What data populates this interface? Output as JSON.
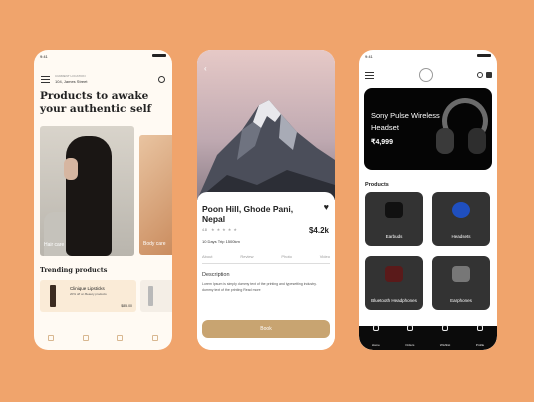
{
  "phone1": {
    "time": "9:41",
    "location_label": "CURRENT LOCATION",
    "location": "104, James Street",
    "headline": "Products to awake your authentic self",
    "card1_label": "Hair care",
    "card2_label": "Body care",
    "trending_title": "Trending products",
    "product": {
      "name": "Clinique Lipsticks",
      "desc": "20% off on Beauty products",
      "price": "$85.00"
    }
  },
  "phone2": {
    "title": "Poon Hill, Ghode Pani, Nepal",
    "rating": "4.8",
    "stars": "★★★★★",
    "price": "$4.2k",
    "trip": "10 Days Trip  1500km",
    "tabs": [
      "About",
      "Review",
      "Photo",
      "Video"
    ],
    "desc_title": "Description",
    "desc_text": "Lorem Ipsum is simply dummy text of the printing and typesetting industry. dummy text of the printing Read more",
    "book_label": "Book"
  },
  "phone3": {
    "time": "9:41",
    "banner_title": "Sony Pulse Wireless Headset",
    "banner_price": "₹4,999",
    "products_label": "Products",
    "tiles": [
      "Earbuds",
      "Headsets",
      "Bluetooth Headphones",
      "Earphones"
    ],
    "nav": [
      "Home",
      "Orders",
      "Wishlist",
      "Profile"
    ]
  },
  "colors": {
    "background": "#f0a46c",
    "accent_gold": "#c8a471",
    "dark": "#050505"
  }
}
